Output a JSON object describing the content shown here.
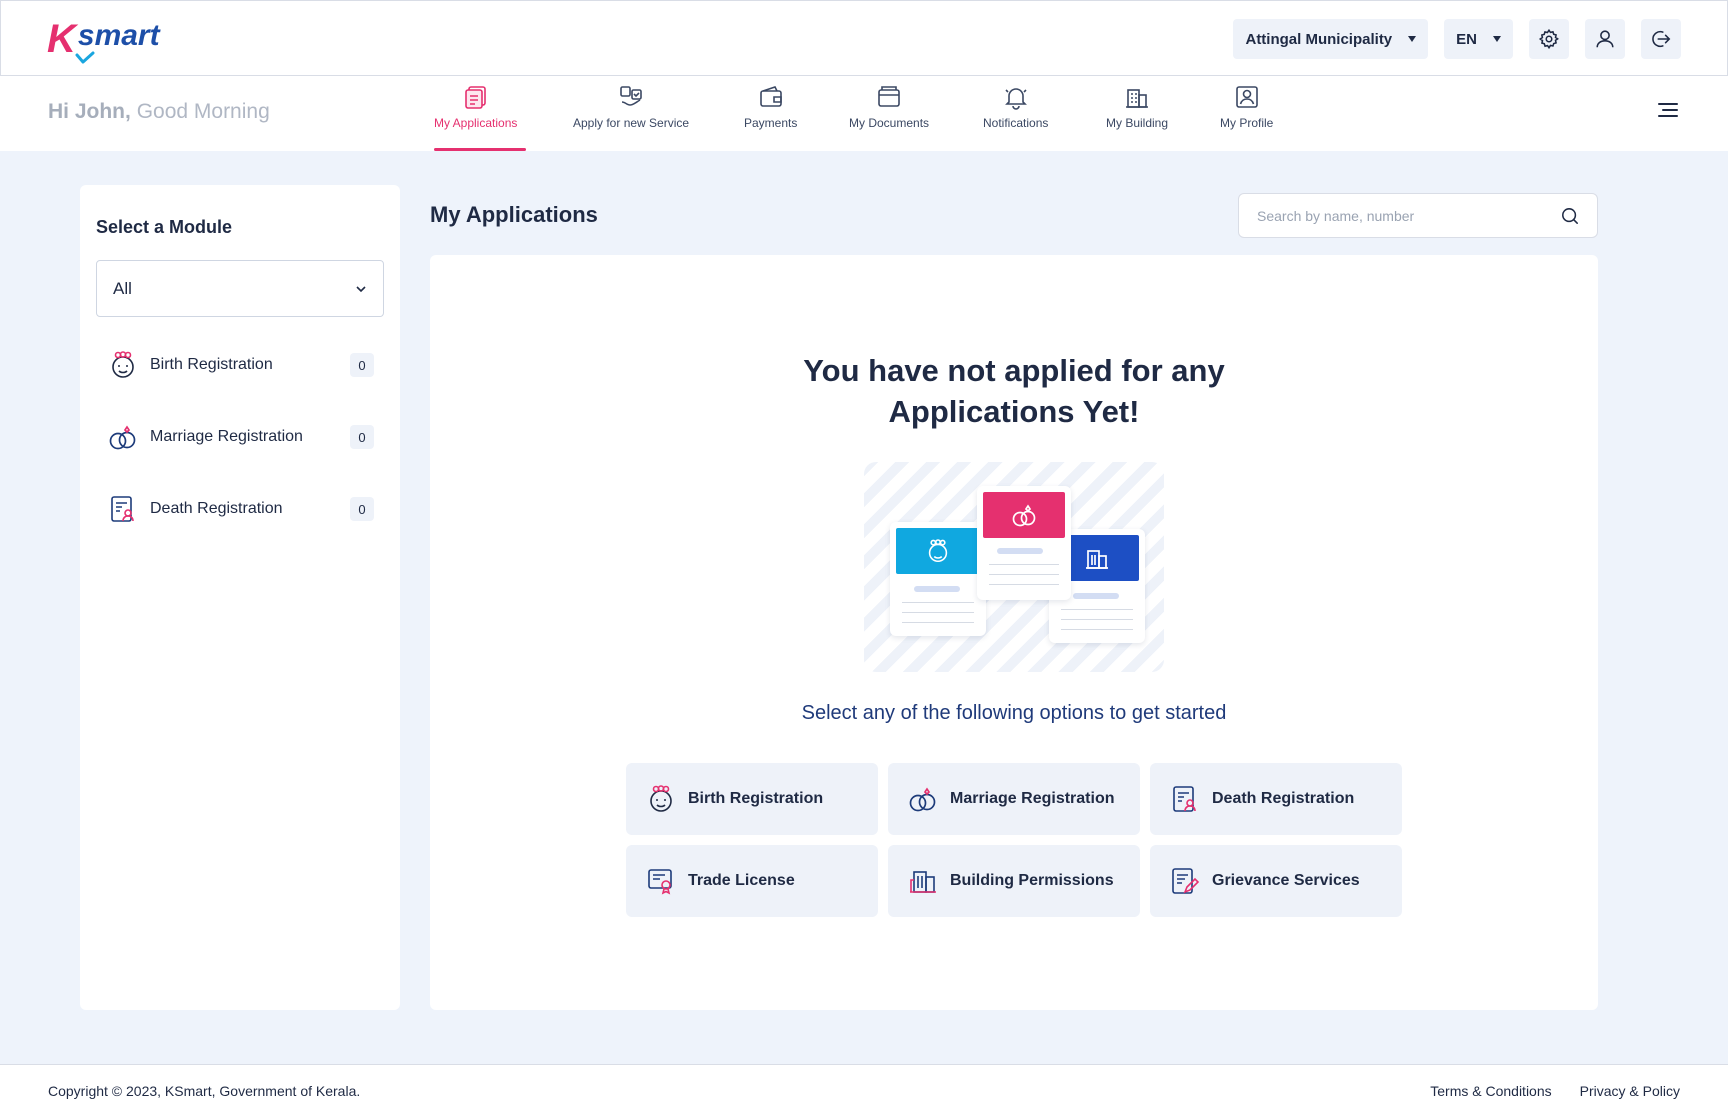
{
  "app": {
    "logo_k": "K",
    "logo_smart": "smart",
    "brand_pink": "#e5306f",
    "brand_blue": "#1d4fa8"
  },
  "header": {
    "municipality": "Attingal Municipality",
    "language": "EN",
    "settings_icon": "gear-icon",
    "user_icon": "user-icon",
    "logout_icon": "logout-icon"
  },
  "greeting": {
    "name": "Hi John,",
    "message": "Good Morning"
  },
  "nav": {
    "items": [
      {
        "label": "My Applications",
        "icon": "applications-icon",
        "active": true
      },
      {
        "label": "Apply for new Service",
        "icon": "apply-service-icon",
        "active": false
      },
      {
        "label": "Payments",
        "icon": "wallet-icon",
        "active": false
      },
      {
        "label": "My Documents",
        "icon": "documents-icon",
        "active": false
      },
      {
        "label": "Notifications",
        "icon": "bell-icon",
        "active": false
      },
      {
        "label": "My Building",
        "icon": "building-icon",
        "active": false
      },
      {
        "label": "My Profile",
        "icon": "profile-icon",
        "active": false
      }
    ]
  },
  "sidebar": {
    "title": "Select a Module",
    "selected_module": "All",
    "modules": [
      {
        "label": "Birth Registration",
        "count": "0",
        "icon": "baby-icon"
      },
      {
        "label": "Marriage Registration",
        "count": "0",
        "icon": "rings-icon"
      },
      {
        "label": "Death Registration",
        "count": "0",
        "icon": "certificate-icon"
      }
    ]
  },
  "main": {
    "title": "My Applications",
    "search_placeholder": "Search by name, number",
    "empty_title_line1": "You have not applied for any",
    "empty_title_line2": "Applications Yet!",
    "subtitle": "Select any of the following options to get started",
    "options": [
      {
        "label": "Birth Registration",
        "icon": "baby-icon"
      },
      {
        "label": "Marriage Registration",
        "icon": "rings-icon"
      },
      {
        "label": "Death Registration",
        "icon": "certificate-icon"
      },
      {
        "label": "Trade License",
        "icon": "license-icon"
      },
      {
        "label": "Building Permissions",
        "icon": "building-icon"
      },
      {
        "label": "Grievance Services",
        "icon": "grievance-icon"
      }
    ]
  },
  "footer": {
    "copyright": "Copyright © 2023, KSmart, Government of Kerala.",
    "terms": "Terms & Conditions",
    "privacy": "Privacy & Policy"
  }
}
